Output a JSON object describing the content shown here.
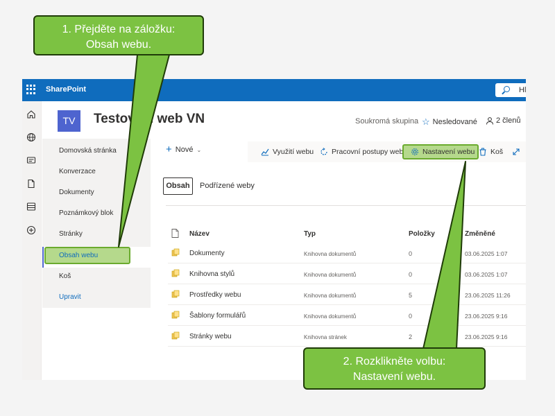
{
  "callouts": {
    "step1_line1": "1. Přejděte na záložku:",
    "step1_line2": "Obsah webu.",
    "step2_line1": "2. Rozklikněte volbu:",
    "step2_line2": "Nastavení webu."
  },
  "suitebar": {
    "brand": "SharePoint",
    "search_text": "Hl"
  },
  "site": {
    "logo_initials": "TV",
    "title": "Testovací web VN",
    "privacy": "Soukromá skupina",
    "follow_label": "Nesledované",
    "members_label": "2 členů"
  },
  "leftnav": {
    "items": [
      {
        "label": "Domovská stránka"
      },
      {
        "label": "Konverzace"
      },
      {
        "label": "Dokumenty"
      },
      {
        "label": "Poznámkový blok"
      },
      {
        "label": "Stránky"
      },
      {
        "label": "Obsah webu"
      },
      {
        "label": "Koš"
      },
      {
        "label": "Upravit"
      }
    ]
  },
  "commandbar": {
    "new_label": "Nové",
    "usage_label": "Využití webu",
    "workflows_label": "Pracovní postupy webu",
    "settings_label": "Nastavení webu",
    "recycle_label": "Koš"
  },
  "tabs": {
    "content_label": "Obsah",
    "subsites_label": "Podřízené weby"
  },
  "table": {
    "headers": {
      "name": "Název",
      "type": "Typ",
      "items": "Položky",
      "modified": "Změněné"
    },
    "rows": [
      {
        "name": "Dokumenty",
        "type": "Knihovna dokumentů",
        "items": "0",
        "modified": "03.06.2025 1:07"
      },
      {
        "name": "Knihovna stylů",
        "type": "Knihovna dokumentů",
        "items": "0",
        "modified": "03.06.2025 1:07"
      },
      {
        "name": "Prostředky webu",
        "type": "Knihovna dokumentů",
        "items": "5",
        "modified": "23.06.2025 11:26"
      },
      {
        "name": "Šablony formulářů",
        "type": "Knihovna dokumentů",
        "items": "0",
        "modified": "23.06.2025 9:16"
      },
      {
        "name": "Stránky webu",
        "type": "Knihovna stránek",
        "items": "2",
        "modified": "23.06.2025 9:16"
      }
    ]
  },
  "colors": {
    "suitebar": "#0f6cbd",
    "site_logo": "#4e64cf",
    "callout_fill": "#7cc242",
    "highlight_fill": "#b5d98c"
  }
}
